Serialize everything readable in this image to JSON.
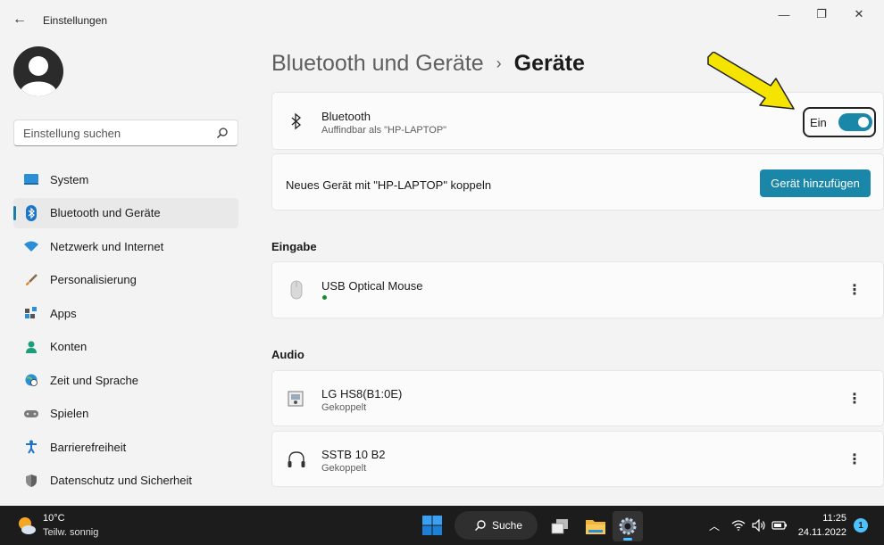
{
  "window": {
    "back_glyph": "←",
    "title": "Einstellungen",
    "min_glyph": "—",
    "max_glyph": "❐",
    "close_glyph": "✕"
  },
  "search": {
    "placeholder": "Einstellung suchen"
  },
  "sidebar": {
    "items": [
      {
        "label": "System",
        "icon": "monitor-icon"
      },
      {
        "label": "Bluetooth und Geräte",
        "icon": "bluetooth-icon",
        "active": true
      },
      {
        "label": "Netzwerk und Internet",
        "icon": "wifi-icon"
      },
      {
        "label": "Personalisierung",
        "icon": "brush-icon"
      },
      {
        "label": "Apps",
        "icon": "apps-icon"
      },
      {
        "label": "Konten",
        "icon": "person-icon"
      },
      {
        "label": "Zeit und Sprache",
        "icon": "globe-clock-icon"
      },
      {
        "label": "Spielen",
        "icon": "gamepad-icon"
      },
      {
        "label": "Barrierefreiheit",
        "icon": "accessibility-icon"
      },
      {
        "label": "Datenschutz und Sicherheit",
        "icon": "shield-icon"
      }
    ]
  },
  "breadcrumb": {
    "parent": "Bluetooth und Geräte",
    "separator": "›",
    "current": "Geräte"
  },
  "bluetooth_card": {
    "title": "Bluetooth",
    "subtitle": "Auffindbar als \"HP-LAPTOP\"",
    "toggle_label": "Ein",
    "toggle_on": true
  },
  "pair_card": {
    "label": "Neues Gerät mit \"HP-LAPTOP\" koppeln",
    "button": "Gerät hinzufügen"
  },
  "sections": {
    "input": {
      "title": "Eingabe",
      "devices": [
        {
          "name": "USB Optical Mouse",
          "status_color": "#1b8a2f"
        }
      ]
    },
    "audio": {
      "title": "Audio",
      "devices": [
        {
          "name": "LG HS8(B1:0E)",
          "status": "Gekoppelt"
        },
        {
          "name": "SSTB 10 B2",
          "status": "Gekoppelt"
        }
      ]
    }
  },
  "more_glyph": "⋮",
  "taskbar": {
    "weather_temp": "10°C",
    "weather_desc": "Teilw. sonnig",
    "search_label": "Suche",
    "time": "11:25",
    "date": "24.11.2022",
    "notifications": "1",
    "tray_chevron": "︿"
  },
  "colors": {
    "accent": "#1a86a8",
    "highlight_arrow": "#f5e400"
  }
}
